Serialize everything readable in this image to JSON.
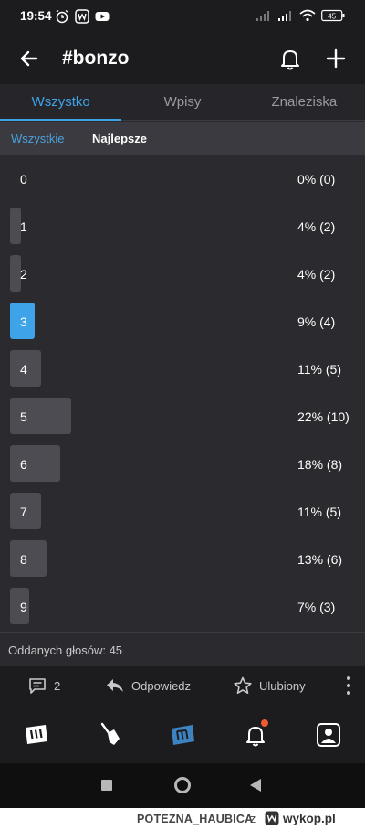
{
  "status": {
    "time": "19:54",
    "battery": "45"
  },
  "header": {
    "title": "#bonzo"
  },
  "tabs": [
    {
      "label": "Wszystko",
      "active": true
    },
    {
      "label": "Wpisy",
      "active": false
    },
    {
      "label": "Znaleziska",
      "active": false
    }
  ],
  "filters": {
    "all": "Wszystkie",
    "best": "Najlepsze"
  },
  "poll": {
    "options": [
      {
        "label": "0",
        "percent_text": "0% (0)",
        "share": 0
      },
      {
        "label": "1",
        "percent_text": "4% (2)",
        "share": 4
      },
      {
        "label": "2",
        "percent_text": "4% (2)",
        "share": 4
      },
      {
        "label": "3",
        "percent_text": "9% (4)",
        "share": 9,
        "selected": true
      },
      {
        "label": "4",
        "percent_text": "11% (5)",
        "share": 11
      },
      {
        "label": "5",
        "percent_text": "22% (10)",
        "share": 22
      },
      {
        "label": "6",
        "percent_text": "18% (8)",
        "share": 18
      },
      {
        "label": "7",
        "percent_text": "11% (5)",
        "share": 11
      },
      {
        "label": "8",
        "percent_text": "13% (6)",
        "share": 13
      },
      {
        "label": "9",
        "percent_text": "7% (3)",
        "share": 7
      }
    ],
    "votes_total": "Oddanych głosów: 45"
  },
  "actions": {
    "comments_count": "2",
    "reply": "Odpowiedz",
    "favorite": "Ulubiony"
  },
  "nav": {
    "items": [
      "wykop-home-icon",
      "shovel-icon",
      "mikroblog-icon",
      "notifications-icon",
      "profile-icon"
    ]
  },
  "watermark": {
    "user": "POTEZNA_HAUBICA",
    "z": "z",
    "site": "wykop.pl"
  },
  "colors": {
    "accent": "#3ea3e8",
    "background": "#2b2b2f",
    "bar": "#4c4c52",
    "notification_dot": "#ef5a2e"
  }
}
